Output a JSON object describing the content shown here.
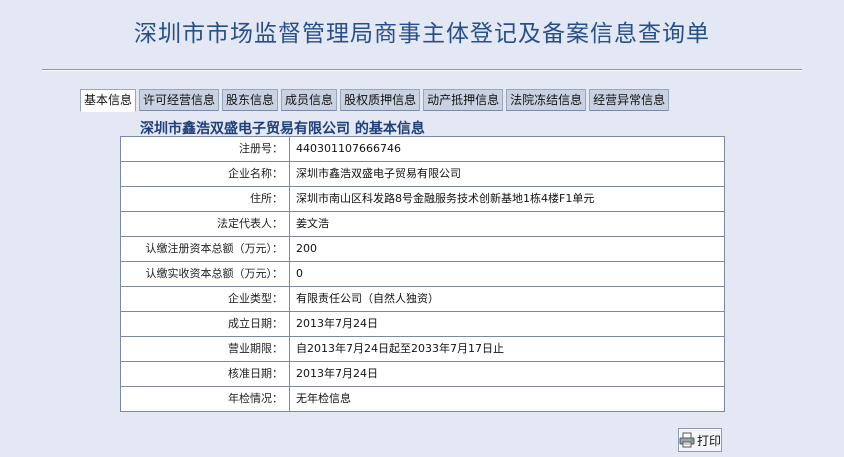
{
  "page": {
    "title": "深圳市市场监督管理局商事主体登记及备案信息查询单"
  },
  "tabs": [
    {
      "label": "基本信息",
      "active": true
    },
    {
      "label": "许可经营信息",
      "active": false
    },
    {
      "label": "股东信息",
      "active": false
    },
    {
      "label": "成员信息",
      "active": false
    },
    {
      "label": "股权质押信息",
      "active": false
    },
    {
      "label": "动产抵押信息",
      "active": false
    },
    {
      "label": "法院冻结信息",
      "active": false
    },
    {
      "label": "经营异常信息",
      "active": false
    }
  ],
  "section": {
    "heading": "深圳市鑫浩双盛电子贸易有限公司 的基本信息"
  },
  "rows": [
    {
      "label": "注册号：",
      "value": "440301107666746"
    },
    {
      "label": "企业名称：",
      "value": "深圳市鑫浩双盛电子贸易有限公司"
    },
    {
      "label": "住所：",
      "value": "深圳市南山区科发路8号金融服务技术创新基地1栋4楼F1单元"
    },
    {
      "label": "法定代表人：",
      "value": "姜文浩"
    },
    {
      "label": "认缴注册资本总额（万元）：",
      "value": "200"
    },
    {
      "label": "认缴实收资本总额（万元）：",
      "value": "0"
    },
    {
      "label": "企业类型：",
      "value": "有限责任公司（自然人独资）"
    },
    {
      "label": "成立日期：",
      "value": "2013年7月24日"
    },
    {
      "label": "营业期限：",
      "value": "自2013年7月24日起至2033年7月17日止"
    },
    {
      "label": "核准日期：",
      "value": "2013年7月24日"
    },
    {
      "label": "年检情况：",
      "value": "无年检信息"
    }
  ],
  "print": {
    "label": "打印",
    "icon": "printer-icon"
  }
}
